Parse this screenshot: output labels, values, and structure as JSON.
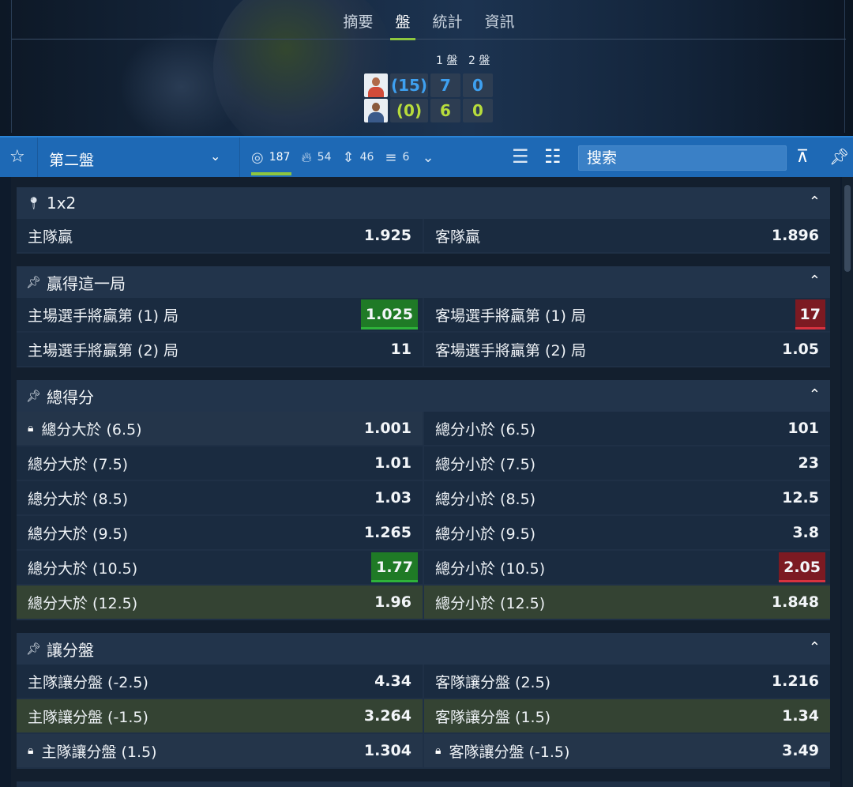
{
  "tabs": [
    "摘要",
    "盤",
    "統計",
    "資訊"
  ],
  "active_tab": 1,
  "scoreboard": {
    "set_headers": [
      "1 盤",
      "2 盤"
    ],
    "players": [
      {
        "seed": "(15)",
        "sets": [
          "7",
          "0"
        ]
      },
      {
        "seed": "(0)",
        "sets": [
          "6",
          "0"
        ]
      }
    ]
  },
  "toolbar": {
    "star": "☆",
    "period_select": "第二盤",
    "stats": [
      {
        "icon": "target-icon",
        "value": "187"
      },
      {
        "icon": "fire-icon",
        "value": "54"
      },
      {
        "icon": "updown-arrows-icon",
        "value": "46"
      },
      {
        "icon": "bar-ladder-icon",
        "value": "6"
      }
    ],
    "search_placeholder": "搜索"
  },
  "markets": [
    {
      "title": "1x2",
      "rows": [
        [
          {
            "label": "主隊贏",
            "odd": "1.925"
          },
          {
            "label": "客隊贏",
            "odd": "1.896"
          }
        ]
      ]
    },
    {
      "title": "贏得這一局",
      "rows": [
        [
          {
            "label": "主場選手將贏第 (1) 局",
            "odd": "1.025",
            "trend": "up"
          },
          {
            "label": "客場選手將贏第 (1) 局",
            "odd": "17",
            "trend": "down"
          }
        ],
        [
          {
            "label": "主場選手將贏第 (2) 局",
            "odd": "11"
          },
          {
            "label": "客場選手將贏第 (2) 局",
            "odd": "1.05"
          }
        ]
      ]
    },
    {
      "title": "總得分",
      "rows": [
        [
          {
            "label": "總分大於 (6.5)",
            "odd": "1.001",
            "locked": true
          },
          {
            "label": "總分小於 (6.5)",
            "odd": "101"
          }
        ],
        [
          {
            "label": "總分大於 (7.5)",
            "odd": "1.01"
          },
          {
            "label": "總分小於 (7.5)",
            "odd": "23"
          }
        ],
        [
          {
            "label": "總分大於 (8.5)",
            "odd": "1.03"
          },
          {
            "label": "總分小於 (8.5)",
            "odd": "12.5"
          }
        ],
        [
          {
            "label": "總分大於 (9.5)",
            "odd": "1.265"
          },
          {
            "label": "總分小於 (9.5)",
            "odd": "3.8"
          }
        ],
        [
          {
            "label": "總分大於 (10.5)",
            "odd": "1.77",
            "trend": "up"
          },
          {
            "label": "總分小於 (10.5)",
            "odd": "2.05",
            "trend": "down"
          }
        ],
        [
          {
            "label": "總分大於 (12.5)",
            "odd": "1.96",
            "highlight": true
          },
          {
            "label": "總分小於 (12.5)",
            "odd": "1.848",
            "highlight": true
          }
        ]
      ]
    },
    {
      "title": "讓分盤",
      "rows": [
        [
          {
            "label": "主隊讓分盤 (-2.5)",
            "odd": "4.34"
          },
          {
            "label": "客隊讓分盤 (2.5)",
            "odd": "1.216"
          }
        ],
        [
          {
            "label": "主隊讓分盤 (-1.5)",
            "odd": "3.264",
            "highlight": true
          },
          {
            "label": "客隊讓分盤 (1.5)",
            "odd": "1.34",
            "highlight": true
          }
        ],
        [
          {
            "label": "主隊讓分盤 (1.5)",
            "odd": "1.304",
            "locked": true
          },
          {
            "label": "客隊讓分盤 (-1.5)",
            "odd": "3.49",
            "locked": true
          }
        ]
      ]
    }
  ]
}
